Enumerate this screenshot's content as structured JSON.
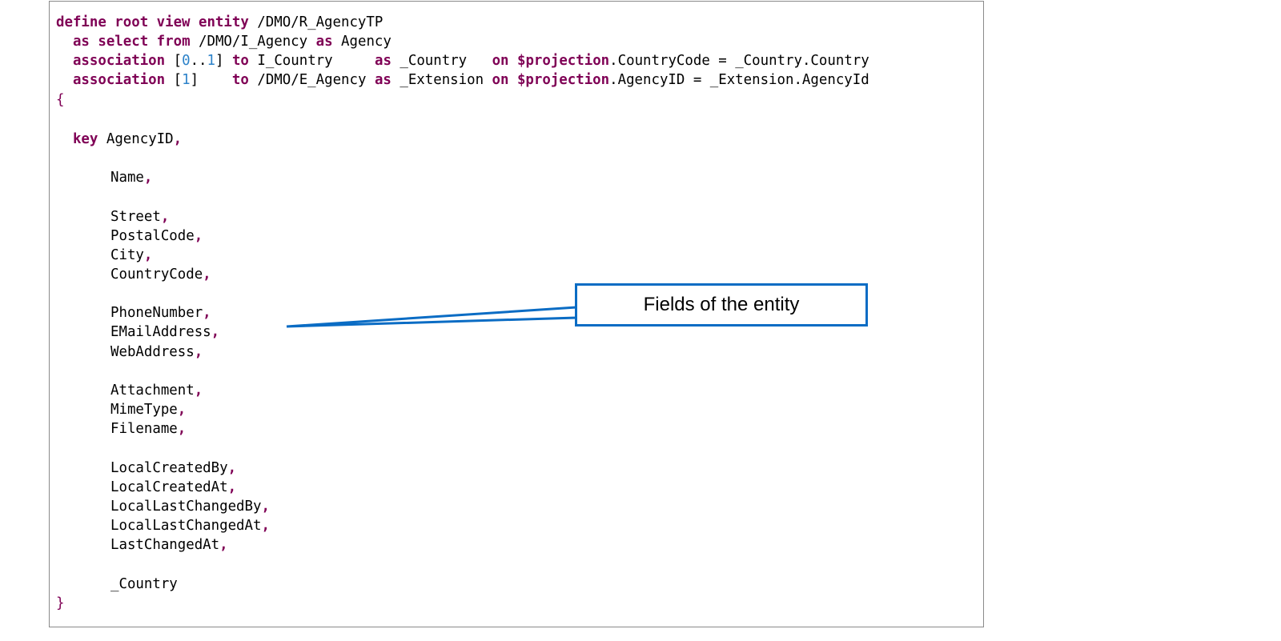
{
  "code": {
    "line1": {
      "kw1": "define root view entity",
      "rest": " /DMO/R_AgencyTP"
    },
    "line2": {
      "indent": "  ",
      "kw1": "as select from",
      "mid": " /DMO/I_Agency ",
      "kw2": "as",
      "rest": " Agency"
    },
    "line3": {
      "indent": "  ",
      "kw1": "association",
      "open": " [",
      "n1": "0",
      "dots": "..",
      "n2": "1",
      "close": "] ",
      "kw2": "to",
      "target": " I_Country     ",
      "kw3": "as",
      "alias": " _Country   ",
      "kw4": "on",
      "cond1": " $projection",
      "cond2": ".CountryCode = _Country.Country"
    },
    "line4": {
      "indent": "  ",
      "kw1": "association",
      "open": " [",
      "n1": "1",
      "close": "]    ",
      "kw2": "to",
      "target": " /DMO/E_Agency ",
      "kw3": "as",
      "alias": " _Extension ",
      "kw4": "on",
      "cond1": " $projection",
      "cond2": ".AgencyID = _Extension.AgencyId"
    },
    "open_brace": "{",
    "key_line": {
      "indent": "  ",
      "kw": "key",
      "field": " AgencyID",
      "comma": ","
    },
    "fields": [
      "Name",
      "Street",
      "PostalCode",
      "City",
      "CountryCode",
      "PhoneNumber",
      "EMailAddress",
      "WebAddress",
      "Attachment",
      "MimeType",
      "Filename",
      "LocalCreatedBy",
      "LocalCreatedAt",
      "LocalLastChangedBy",
      "LocalLastChangedAt",
      "LastChangedAt"
    ],
    "comma": ",",
    "last_field": "_Country",
    "close_brace": "}"
  },
  "callout": {
    "text": "Fields of the entity",
    "border_color": "#0a6cc4"
  },
  "colors": {
    "keyword": "#7f0055",
    "number": "#2c82c9",
    "frame": "#8a8a8a"
  }
}
